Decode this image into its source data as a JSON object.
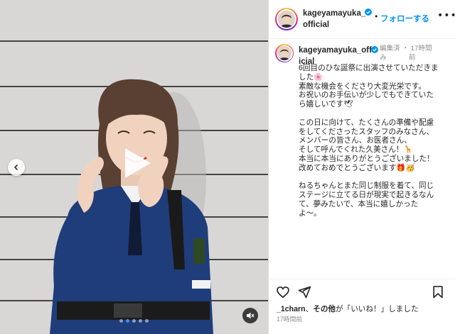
{
  "post": {
    "author": "kageyamayuka_official",
    "author_line1": "kageyamayuka_",
    "author_line2": "official",
    "follow_label": "フォローする",
    "more_label": "•••"
  },
  "caption": {
    "author_line1": "kageyamayuka_off",
    "author_line2": "icial",
    "edited": "編集済",
    "edited_cont": "み",
    "dot": "・",
    "time_line1": "17時間",
    "time_line2": "前",
    "text": "6回目のひな誕祭に出演させていただきま\nした🌸\n素敵な機会をくださり大変光栄です。\nお祝いのお手伝いが少しでもできていた\nら嬉しいです🕊\n\nこの日に向けて、たくさんの準備や配慮\nをしてくださったスタッフのみなさん、\nメンバーの皆さん、お医者さん、\nそして呼んでくれた久美さん！🦒\n本当に本当にありがとうございました！\n改めておめでとうございます🎁🥳\n\nねるちゃんとまた同じ制服を着て、同じ\nステージに立てる日が現実で起きるなん\nて、夢みたいで、本当に嬉しかった\nよ〜。"
  },
  "actions": {
    "likes_user": "_1charn",
    "likes_others": "その他",
    "likes_suffix": "が「いいね！」しました",
    "timestamp": "17時間前"
  },
  "media": {
    "slide_dots": 5,
    "active_dot": 1
  },
  "colors": {
    "accent": "#0095f6",
    "text": "#262626",
    "muted": "#8e8e8e"
  },
  "icons": [
    "chevron-left-icon",
    "play-icon",
    "mute-icon",
    "verified-badge-icon",
    "heart-icon",
    "share-icon",
    "bookmark-icon",
    "more-icon"
  ]
}
